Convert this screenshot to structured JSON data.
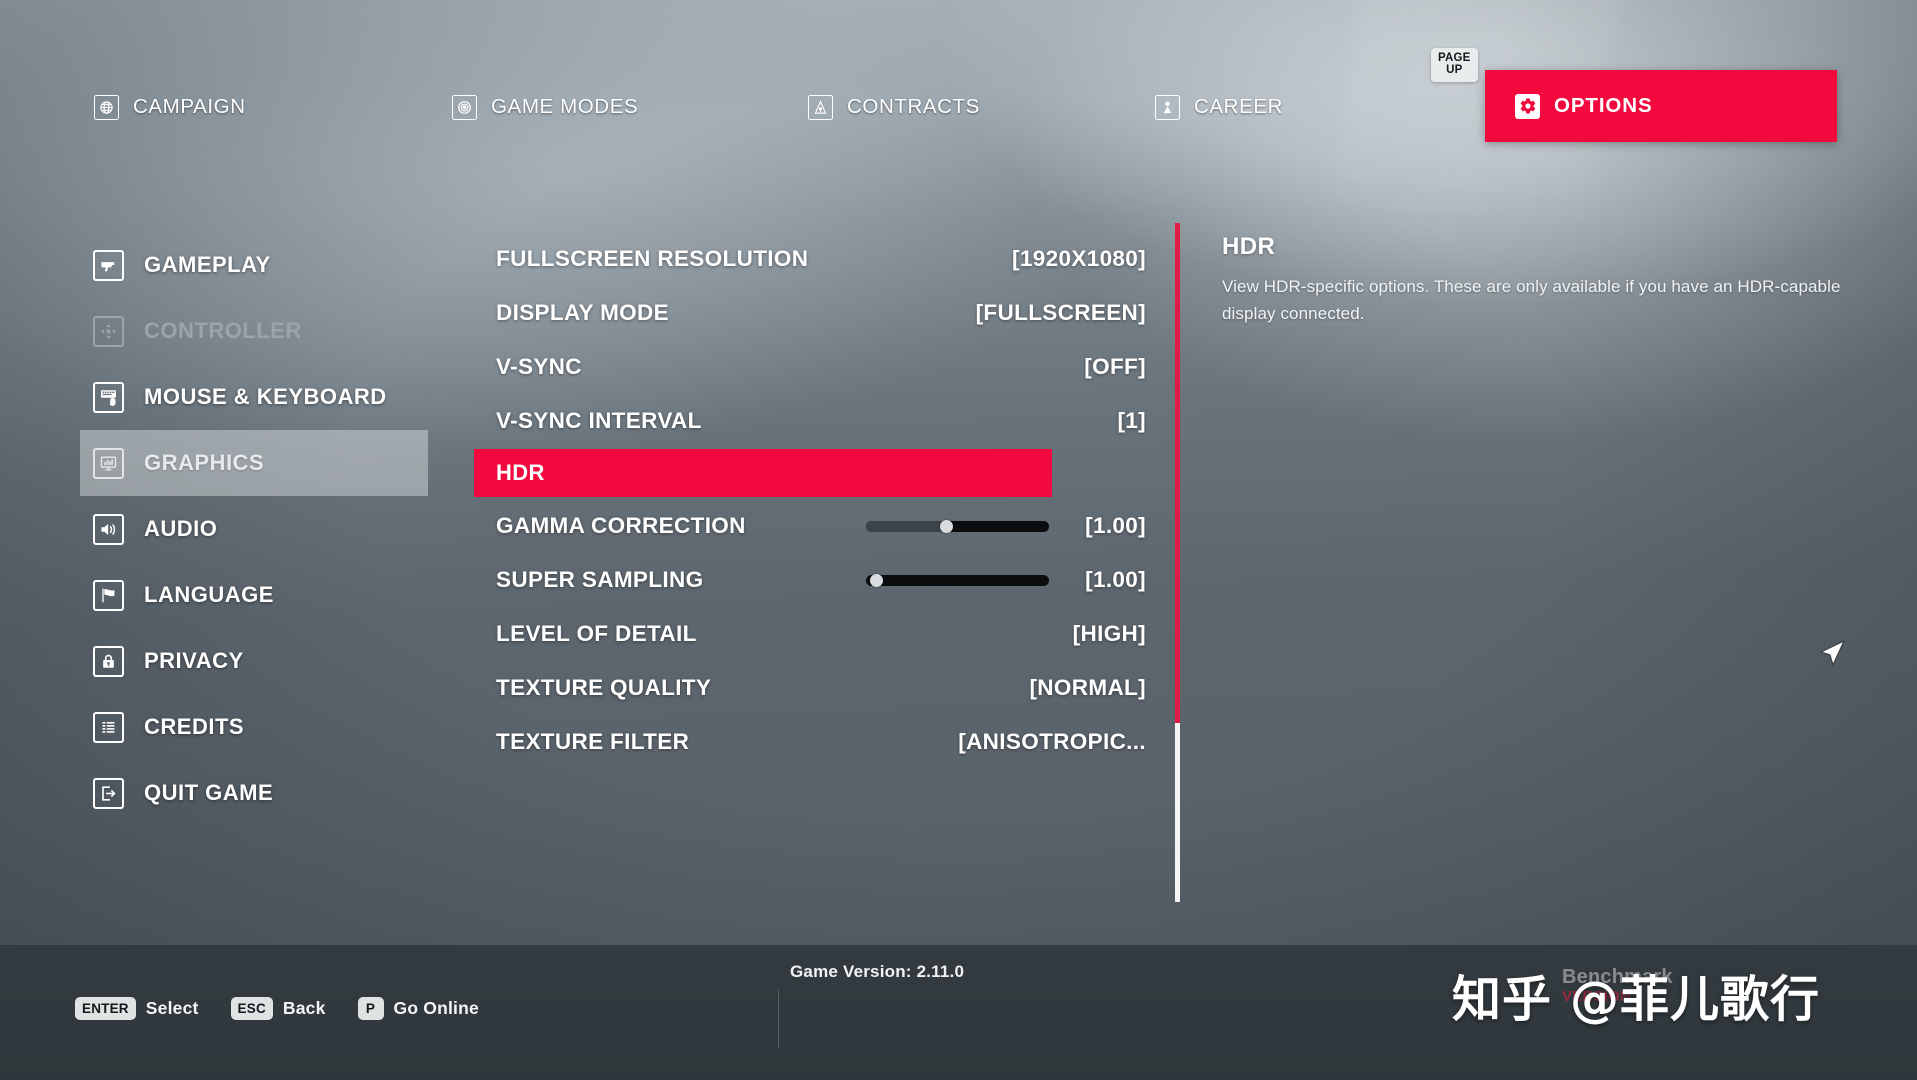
{
  "top_nav": {
    "page_up_badge": "PAGE\nUP",
    "tabs": [
      {
        "label": "CAMPAIGN",
        "icon": "globe-icon",
        "active": false
      },
      {
        "label": "GAME MODES",
        "icon": "target-icon",
        "active": false
      },
      {
        "label": "CONTRACTS",
        "icon": "contract-icon",
        "active": false
      },
      {
        "label": "CAREER",
        "icon": "person-icon",
        "active": false
      },
      {
        "label": "OPTIONS",
        "icon": "gear-icon",
        "active": true
      }
    ]
  },
  "sidebar": {
    "items": [
      {
        "label": "GAMEPLAY",
        "icon": "pistol-icon",
        "state": "normal"
      },
      {
        "label": "CONTROLLER",
        "icon": "dpad-icon",
        "state": "disabled"
      },
      {
        "label": "MOUSE & KEYBOARD",
        "icon": "keyboard-icon",
        "state": "normal"
      },
      {
        "label": "GRAPHICS",
        "icon": "monitor-icon",
        "state": "selected"
      },
      {
        "label": "AUDIO",
        "icon": "speaker-icon",
        "state": "normal"
      },
      {
        "label": "LANGUAGE",
        "icon": "flag-icon",
        "state": "normal"
      },
      {
        "label": "PRIVACY",
        "icon": "lock-icon",
        "state": "normal"
      },
      {
        "label": "CREDITS",
        "icon": "list-icon",
        "state": "normal"
      },
      {
        "label": "QUIT GAME",
        "icon": "exit-icon",
        "state": "normal"
      }
    ]
  },
  "settings": {
    "rows": [
      {
        "name": "FULLSCREEN RESOLUTION",
        "value": "[1920X1080]",
        "type": "option",
        "highlight": false
      },
      {
        "name": "DISPLAY MODE",
        "value": "[FULLSCREEN]",
        "type": "option",
        "highlight": false
      },
      {
        "name": "V-SYNC",
        "value": "[OFF]",
        "type": "option",
        "highlight": false
      },
      {
        "name": "V-SYNC INTERVAL",
        "value": "[1]",
        "type": "option",
        "highlight": false
      },
      {
        "name": "HDR",
        "value": "",
        "type": "submenu",
        "highlight": true
      },
      {
        "name": "GAMMA CORRECTION",
        "value": "[1.00]",
        "type": "slider",
        "highlight": false,
        "slider_percent": 47
      },
      {
        "name": "SUPER SAMPLING",
        "value": "[1.00]",
        "type": "slider",
        "highlight": false,
        "slider_percent": 2
      },
      {
        "name": "LEVEL OF DETAIL",
        "value": "[HIGH]",
        "type": "option",
        "highlight": false
      },
      {
        "name": "TEXTURE QUALITY",
        "value": "[NORMAL]",
        "type": "option",
        "highlight": false
      },
      {
        "name": "TEXTURE FILTER",
        "value": "[ANISOTROPIC...",
        "type": "option",
        "highlight": false
      }
    ]
  },
  "description": {
    "title": "HDR",
    "body": "View HDR-specific options. These are only available if you have an HDR-capable display connected."
  },
  "footer": {
    "hints": [
      {
        "key": "ENTER",
        "action": "Select"
      },
      {
        "key": "ESC",
        "action": "Back"
      },
      {
        "key": "P",
        "action": "Go Online"
      }
    ],
    "game_version": "Game Version: 2.11.0",
    "benchmark_overlay": "Benchmark",
    "benchmark_sub": "VERSION",
    "watermark": "知乎 @菲儿歌行"
  },
  "colors": {
    "accent_red": "#f20a3f",
    "divider_red": "#e01b44",
    "divider_white": "#f3f5f6",
    "text_white": "#ffffff",
    "text_disabled": "#9aa4ac",
    "footer_bg": "#2f373c"
  }
}
